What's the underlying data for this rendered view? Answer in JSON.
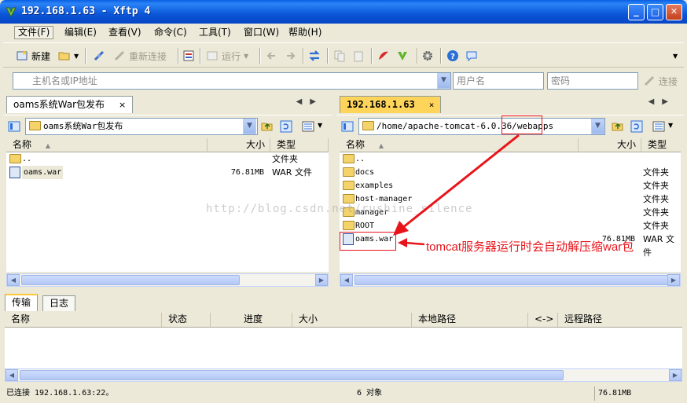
{
  "window": {
    "title": "192.168.1.63 - Xftp 4",
    "btn_min": "_",
    "btn_max": "□",
    "btn_close": "✕"
  },
  "menu": [
    "文件(F)",
    "编辑(E)",
    "查看(V)",
    "命令(C)",
    "工具(T)",
    "窗口(W)",
    "帮助(H)"
  ],
  "toolbar": {
    "new": "新建",
    "reconnect": "重新连接",
    "run": "运行"
  },
  "address": {
    "host_placeholder": "主机名或IP地址",
    "user_placeholder": "用户名",
    "pass_placeholder": "密码",
    "connect": "连接"
  },
  "local": {
    "tab": "oams系统War包发布",
    "tab_close": "×",
    "path": "oams系统War包发布",
    "columns": {
      "name": "名称",
      "size": "大小",
      "type": "类型"
    },
    "rows": [
      {
        "name": "..",
        "size": "",
        "type": "文件夹"
      },
      {
        "name": "oams.war",
        "size": "76.81MB",
        "type": "WAR 文件"
      }
    ]
  },
  "remote": {
    "tab": "192.168.1.63",
    "tab_close": "×",
    "path_prefix": "/home/apache-tomcat-6.0.36/",
    "path_highlight": "webapps",
    "columns": {
      "name": "名称",
      "size": "大小",
      "type": "类型"
    },
    "rows": [
      {
        "name": "..",
        "size": "",
        "type": ""
      },
      {
        "name": "docs",
        "size": "",
        "type": "文件夹"
      },
      {
        "name": "examples",
        "size": "",
        "type": "文件夹"
      },
      {
        "name": "host-manager",
        "size": "",
        "type": "文件夹"
      },
      {
        "name": "manager",
        "size": "",
        "type": "文件夹"
      },
      {
        "name": "ROOT",
        "size": "",
        "type": "文件夹"
      },
      {
        "name": "oams.war",
        "size": "76.81MB",
        "type": "WAR 文件"
      }
    ]
  },
  "transfer": {
    "tabs": [
      "传输",
      "日志"
    ],
    "columns": [
      "名称",
      "状态",
      "进度",
      "大小",
      "本地路径",
      "<->",
      "远程路径"
    ]
  },
  "status": {
    "connection": "已连接 192.168.1.63:22。",
    "objects": "6 对象",
    "size": "76.81MB"
  },
  "watermark": "http://blog.csdn.net/rushine_silence",
  "annotation": "tomcat服务器运行时会自动解压缩war包",
  "colors": {
    "annotation": "#e8141a",
    "title_bar": "#0b56d8",
    "remote_tab": "#ffd45a"
  }
}
